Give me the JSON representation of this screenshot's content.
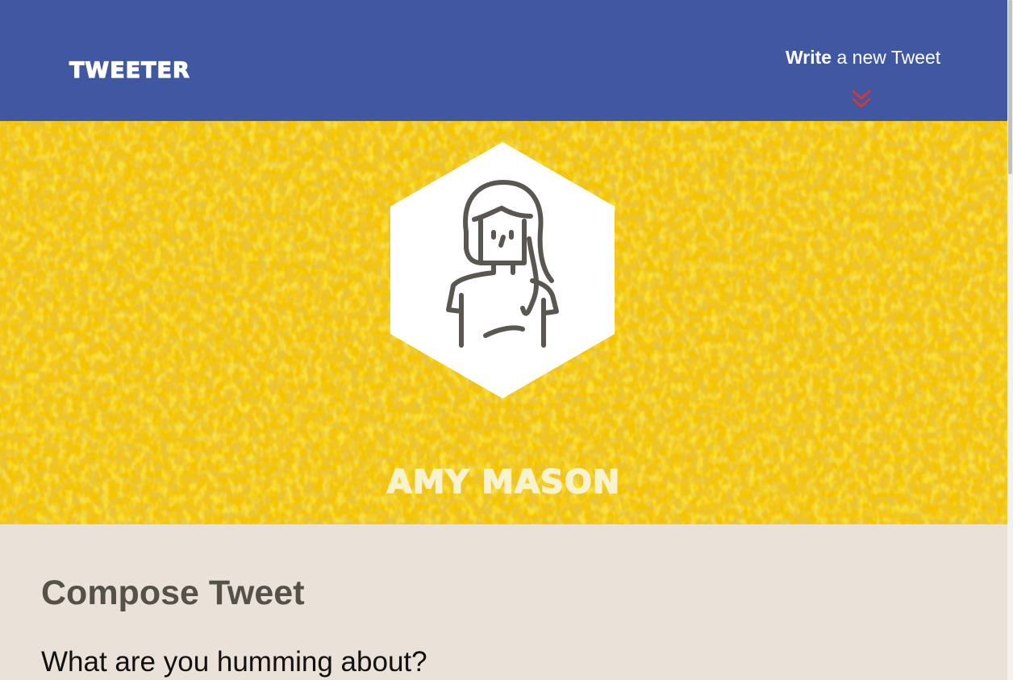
{
  "nav": {
    "brand": "Tweeter",
    "write_bold": "Write",
    "write_rest": " a new Tweet",
    "chevron_icon": "double-chevron-down-icon"
  },
  "profile": {
    "name": "Amy Mason",
    "avatar_icon": "female-user-avatar-icon"
  },
  "compose": {
    "title": "Compose Tweet",
    "prompt": "What are you humming about?"
  },
  "colors": {
    "nav_bg": "#4057a2",
    "header_yellow": "#f5c400",
    "page_bg": "#eae1d8",
    "accent_red": "#e2352a",
    "text_dark": "#545149"
  }
}
